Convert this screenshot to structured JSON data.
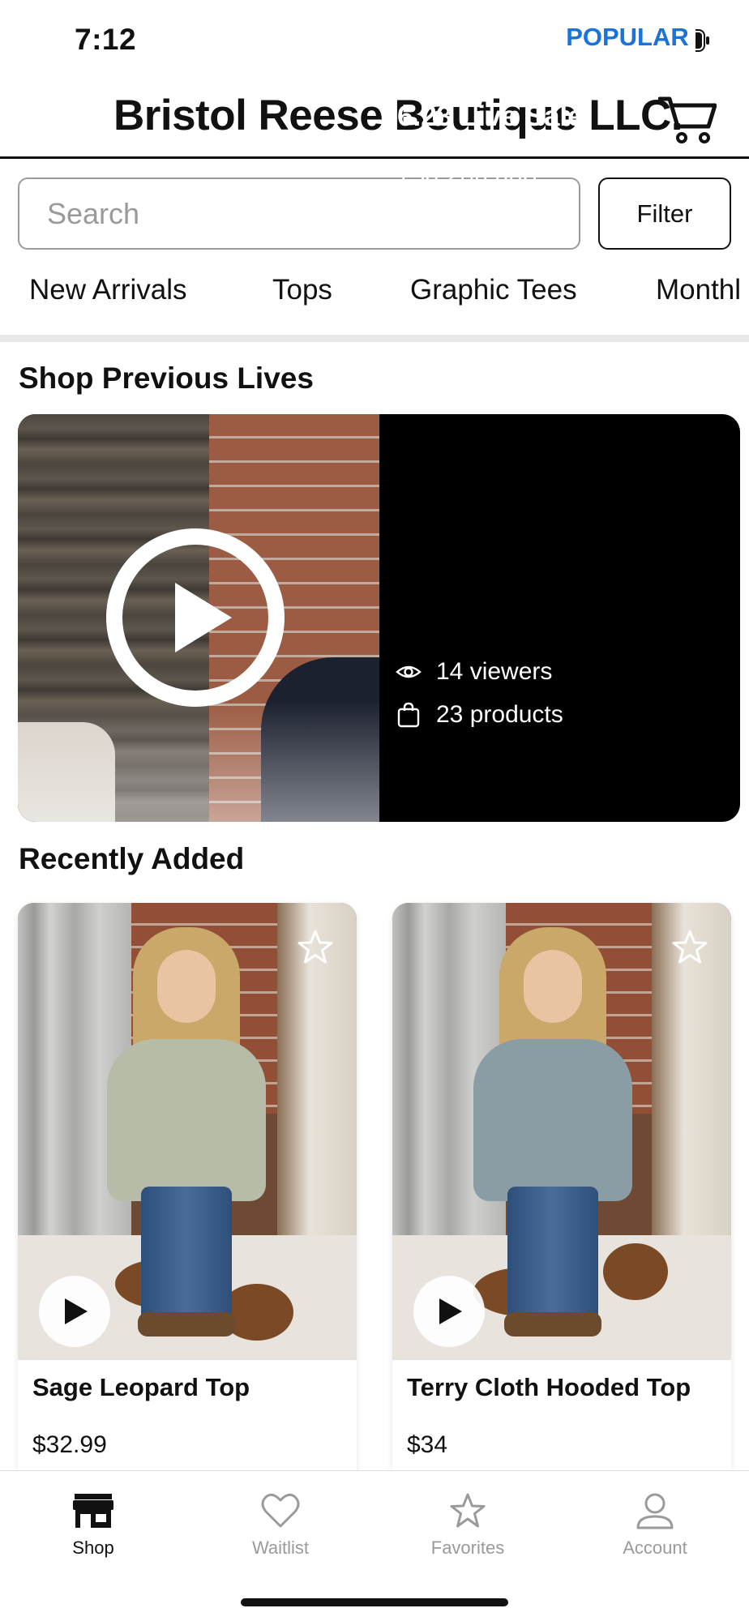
{
  "status_bar": {
    "time": "7:12"
  },
  "header": {
    "title": "Bristol Reese Boutique LLC."
  },
  "search": {
    "placeholder": "Search",
    "value": "",
    "filter_label": "Filter"
  },
  "categories": [
    "New Arrivals",
    "Tops",
    "Graphic Tees",
    "Monthl"
  ],
  "sections": {
    "previous_lives_title": "Shop Previous Lives",
    "recently_added_title": "Recently Added"
  },
  "live_card": {
    "badge": "POPULAR",
    "title": "6.23 Live Sale",
    "time_ago": "75d 20h ago",
    "viewers": "14 viewers",
    "products": "23 products"
  },
  "products": [
    {
      "name": "Sage Leopard Top",
      "price": "$32.99",
      "top_color": "#b6bca8"
    },
    {
      "name": "Terry Cloth Hooded Top",
      "price": "$34",
      "top_color": "#8a9ca4"
    }
  ],
  "tab_bar": {
    "tabs": [
      {
        "label": "Shop",
        "icon": "shop-icon",
        "active": true
      },
      {
        "label": "Waitlist",
        "icon": "heart-icon",
        "active": false
      },
      {
        "label": "Favorites",
        "icon": "star-icon",
        "active": false
      },
      {
        "label": "Account",
        "icon": "account-icon",
        "active": false
      }
    ]
  },
  "colors": {
    "badge_text": "#1a73d9",
    "live_card_bg": "#000000",
    "inactive_tab": "#9a9a9a"
  }
}
